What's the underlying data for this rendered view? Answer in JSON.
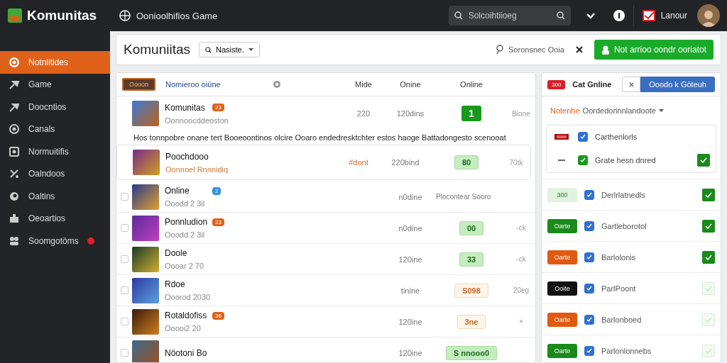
{
  "topbar": {
    "logo": "Komunitas",
    "section": "Oonioolhifios Game",
    "search": {
      "placeholder": "Solcoihtiioeg"
    },
    "user": "Lanour"
  },
  "sidebar": {
    "items": [
      {
        "label": "Notnlitides",
        "selected": true,
        "alert": false
      },
      {
        "label": "Game",
        "selected": false,
        "alert": false
      },
      {
        "label": "Doocntios",
        "selected": false,
        "alert": false
      },
      {
        "label": "Canals",
        "selected": false,
        "alert": false
      },
      {
        "label": "Normuitifis",
        "selected": false,
        "alert": false
      },
      {
        "label": "Oalndoos",
        "selected": false,
        "alert": false
      },
      {
        "label": "Oaltins",
        "selected": false,
        "alert": false
      },
      {
        "label": "Oeoartios",
        "selected": false,
        "alert": false
      },
      {
        "label": "Soomgotöms",
        "selected": false,
        "alert": true
      }
    ]
  },
  "header": {
    "title": "Komuniitas",
    "filter": {
      "value": "Nasiste."
    },
    "location": "Soronsnec Ooia",
    "action": "Not arrioo oondr ooriatot"
  },
  "table": {
    "tag": "Oooon",
    "link": "Nomieroo oiüne",
    "columns": [
      "Mide",
      "Onine",
      "Online"
    ],
    "rows": [
      {
        "kind": "plain",
        "title": "Komunitas",
        "badge": {
          "text": "23",
          "color": "#e0611a"
        },
        "subtitle": "Oonnoocddeoston",
        "col_1": "220",
        "col_2": "120dins",
        "pill": {
          "text": "1",
          "kind": "solid"
        },
        "trail": "Bione",
        "note": "Hos tonnpobre onane tert Booeoontinos olcire Ooaro endedresktchter estos haoge Battadongesto scenooat"
      },
      {
        "kind": "nested",
        "title": "Poochdooo",
        "subtitle": "Oonnoel Rnnnidiq",
        "col_1": "#dont",
        "col_2": "220bind",
        "pill": {
          "text": "80",
          "kind": "light"
        },
        "trail": "70tk"
      },
      {
        "kind": "item",
        "checked": false,
        "title": "Online",
        "badge": {
          "text": "2",
          "color": "#2f8fe0"
        },
        "subtitle": "Ooodd 2 3il",
        "col_2": "n0dine",
        "col_3": "Plocontear Sooro"
      },
      {
        "kind": "item",
        "checked": false,
        "title": "Ponnludion",
        "badge": {
          "text": "23",
          "color": "#e0611a"
        },
        "subtitle": "Ooodd 2 3il",
        "col_2": "n0dine",
        "pill": {
          "text": "00",
          "kind": "light"
        },
        "trail": "-ck"
      },
      {
        "kind": "item",
        "checked": false,
        "title": "Doole",
        "subtitle": "Oooar 2 70",
        "col_2": "120ine",
        "pill": {
          "text": "33",
          "kind": "light"
        },
        "trail": "-ck"
      },
      {
        "kind": "item",
        "checked": false,
        "title": "Rdoe",
        "subtitle": "Ooorod 2030",
        "col_2": "tinine",
        "pill": {
          "text": "S098",
          "kind": "warm"
        },
        "trail": "20eg"
      },
      {
        "kind": "item",
        "checked": false,
        "title": "Rotaldofiss",
        "badge": {
          "text": "36",
          "color": "#e0611a"
        },
        "subtitle": "Ooooi2 20",
        "col_2": "120ine",
        "pill": {
          "text": "3ne",
          "kind": "warm"
        },
        "trail": "×"
      },
      {
        "kind": "item",
        "checked": false,
        "title": "Nöotoni Bo",
        "col_2": "120ine",
        "pill": {
          "text": "S nnooo0",
          "kind": "light"
        }
      }
    ]
  },
  "panel": {
    "tag": "300",
    "title": "Cat Gnline",
    "button": "Ooodo k Göteuh",
    "section": {
      "label": "Notenhe",
      "value": "Oordedorinnlandoote"
    },
    "card_items": [
      {
        "kind": "logo",
        "label": "Carthenlorls",
        "checked": true,
        "color": "#2f6fd6",
        "confirmed": false
      },
      {
        "kind": "dash",
        "label": "Grate hesn dnred",
        "checked": true,
        "color": "#1a9a1a",
        "confirmed": true
      }
    ],
    "rows": [
      {
        "tag": {
          "text": "300",
          "kind": "soft",
          "color": "#dff3df"
        },
        "checked": true,
        "label": "Derlrlatnedls",
        "confirmed": true
      },
      {
        "tag": {
          "text": "Oarte",
          "kind": "solid",
          "color": "#1a8a1a"
        },
        "checked": true,
        "label": "Gartleborotol",
        "confirmed": true
      },
      {
        "tag": {
          "text": "Oarte",
          "kind": "solid",
          "color": "#e05a10"
        },
        "checked": true,
        "label": "Barlolonis",
        "confirmed": true
      },
      {
        "tag": {
          "text": "Ooite",
          "kind": "solid",
          "color": "#111111"
        },
        "checked": true,
        "label": "ParlPoont",
        "confirmed": false
      },
      {
        "tag": {
          "text": "Oarte",
          "kind": "solid",
          "color": "#e05a10"
        },
        "checked": true,
        "label": "Barlonboed",
        "confirmed": false
      },
      {
        "tag": {
          "text": "Oarte",
          "kind": "solid",
          "color": "#1a8a1a"
        },
        "checked": true,
        "label": "Parlonlonnebs",
        "confirmed": false
      }
    ]
  }
}
